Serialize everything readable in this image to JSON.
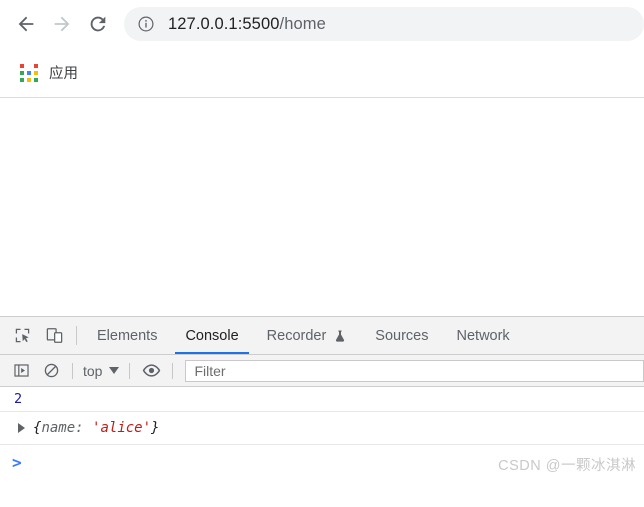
{
  "browser": {
    "nav": {
      "back_icon": "arrow-left-icon",
      "forward_icon": "arrow-right-icon",
      "reload_icon": "reload-icon",
      "back_enabled": true,
      "forward_enabled": false
    },
    "omnibox": {
      "site_info_icon": "info-circle-icon",
      "url_host": "127.0.0.1:5500",
      "url_path": "/home",
      "url_full": "127.0.0.1:5500/home"
    },
    "bookmarks": {
      "items": [
        {
          "icon": "apps-grid-icon",
          "label": "应用"
        }
      ]
    }
  },
  "devtools": {
    "toolbar_icons": [
      {
        "name": "inspect-element-icon",
        "title": "Inspect element"
      },
      {
        "name": "device-toolbar-icon",
        "title": "Toggle device toolbar"
      }
    ],
    "tabs": [
      {
        "label": "Elements",
        "active": false,
        "badge": null
      },
      {
        "label": "Console",
        "active": true,
        "badge": null
      },
      {
        "label": "Recorder",
        "active": false,
        "badge": "flask-icon"
      },
      {
        "label": "Sources",
        "active": false,
        "badge": null
      },
      {
        "label": "Network",
        "active": false,
        "badge": null
      }
    ],
    "console_toolbar": {
      "execute_icon": "execute-sidebar-icon",
      "clear_icon": "clear-console-icon",
      "context_label": "top",
      "context_caret": "chevron-down-icon",
      "eye_icon": "live-expression-eye-icon",
      "filter_placeholder": "Filter",
      "filter_value": ""
    },
    "console_messages": [
      {
        "type": "number",
        "text": "2"
      },
      {
        "type": "object",
        "expandable": true,
        "disclosure_icon": "disclosure-triangle-icon",
        "open_brace": "{",
        "key": "name:",
        "value": "'alice'",
        "close_brace": "}",
        "text": "{name: 'alice'}"
      }
    ],
    "prompt": {
      "chevron": ">",
      "input_value": ""
    }
  },
  "watermark": {
    "text": "CSDN @一颗冰淇淋"
  },
  "colors": {
    "accent_blue": "#1a73e8",
    "prompt_blue": "#3a7afe",
    "number_blue": "#1a1aa6",
    "string_red": "#c41a16",
    "omnibox_bg": "#f1f3f4",
    "devtools_bg": "#f3f3f3",
    "watermark_gray": "#c9c9c9"
  },
  "apps_icon_colors": [
    "#ea4335",
    "#ffffff",
    "#ea4335",
    "#34a853",
    "#4285f4",
    "#fbbc05",
    "#34a853",
    "#fbbc05",
    "#34a853"
  ]
}
